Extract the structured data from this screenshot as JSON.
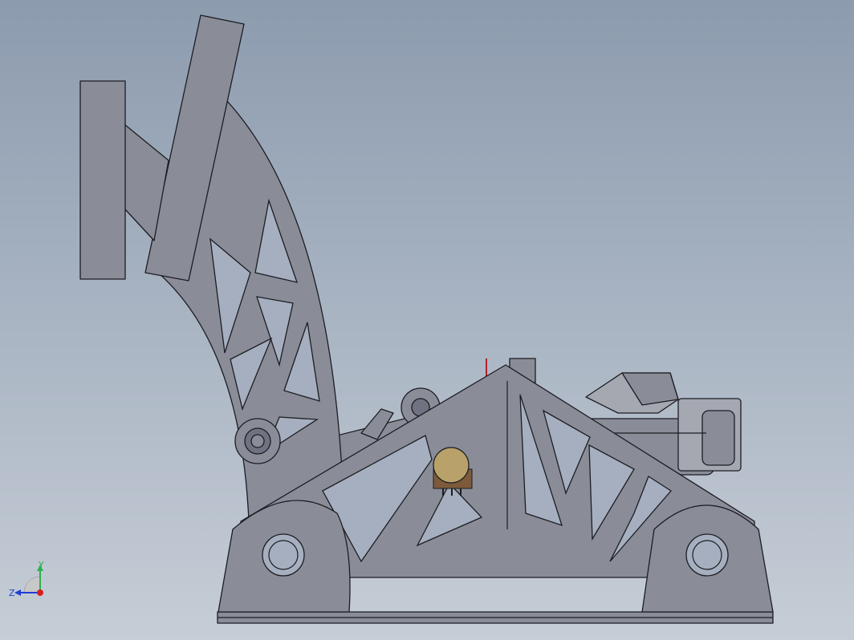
{
  "viewport": {
    "background_top": "#8c9bae",
    "background_bottom": "#c6cdd6",
    "part_color": "#8a8d98",
    "edge_color": "#1c1d22",
    "potentiometer_color": "#b8a26a"
  },
  "triad": {
    "y_label": "Y",
    "z_label": "Z",
    "y_color": "#2bb24c",
    "z_color": "#1f3fd6",
    "x_color": "#d61f1f"
  }
}
